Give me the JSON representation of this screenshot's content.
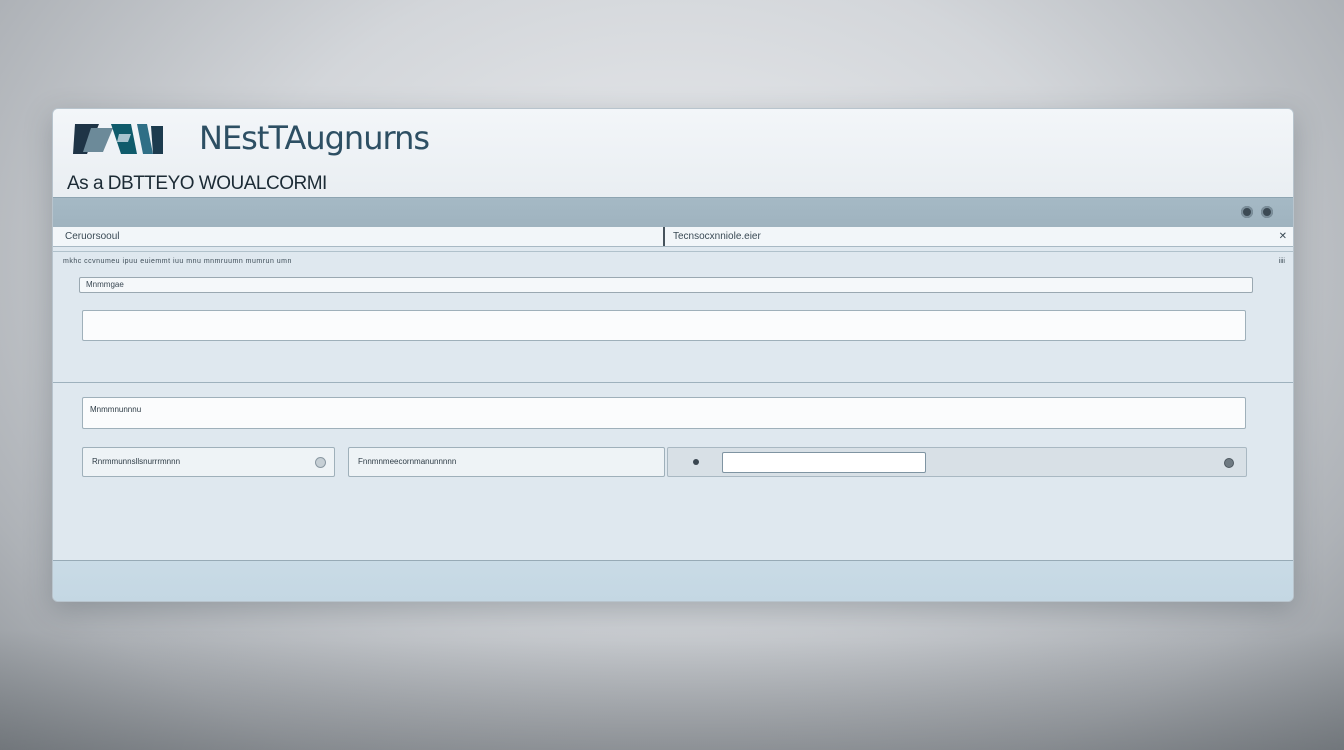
{
  "header": {
    "brand_title": "NEstTAugnurns",
    "subtitle": "As a DBTTEYO WOUALCORMI"
  },
  "tabs": {
    "left_label": "Ceruorsooul",
    "right_label": "Tecnsocxnniole.eier",
    "close_symbol": "✕"
  },
  "breadcrumb": {
    "text": "mkhc ccvnumeu ipuu euiemmt iuu mnu mnmruumn mumrun umn",
    "right": "iiii"
  },
  "form": {
    "field_label": "Mnmmgae",
    "big_input_value": "",
    "second_field_label": "Mnmmnunnnu",
    "select1_label": "Rnrmmunnsllsnurrrmnnn",
    "select2_label": "Fnnmnmeecornmanunnnnn",
    "range_value": ""
  }
}
